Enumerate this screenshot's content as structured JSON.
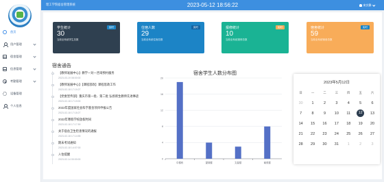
{
  "header": {
    "site_title": "理工学院宿舍管理系统",
    "datetime": "2023-05-12 18:56:22",
    "user_name": "宋文静"
  },
  "sidebar": {
    "items": [
      {
        "label": "首页",
        "icon": "home-icon",
        "active": true,
        "has_children": false
      },
      {
        "label": "用户管理",
        "icon": "user-icon",
        "active": false,
        "has_children": true
      },
      {
        "label": "宿舍管理",
        "icon": "box-icon",
        "active": false,
        "has_children": true
      },
      {
        "label": "信息管理",
        "icon": "box-icon",
        "active": false,
        "has_children": true
      },
      {
        "label": "考勤管理",
        "icon": "clock-icon",
        "active": false,
        "has_children": true
      },
      {
        "label": "设备管理",
        "icon": "gear-icon",
        "active": false,
        "has_children": false
      },
      {
        "label": "个人信息",
        "icon": "person-icon",
        "active": false,
        "has_children": false
      }
    ]
  },
  "stats": [
    {
      "title": "学生统计",
      "badge": "实时",
      "value": "30",
      "sub": "当前全系统学生总数",
      "bg": "#2f4050",
      "badge_bg": "#1c84c6"
    },
    {
      "title": "住宿人数",
      "badge": "实时",
      "value": "29",
      "sub": "当前全系统住宿总数",
      "bg": "#1c84c6",
      "badge_bg": "#1565a3"
    },
    {
      "title": "报修统计",
      "badge": "实时",
      "value": "10",
      "sub": "当前全系统报修总数",
      "bg": "#1ab394",
      "badge_bg": "#f8ac59"
    },
    {
      "title": "宿舍统计",
      "badge": "实时",
      "value": "59",
      "sub": "当前全系统宿舍总数",
      "bg": "#f8ac59",
      "badge_bg": "#1c84c6"
    }
  ],
  "notices": {
    "title": "宿舍通告",
    "items": [
      {
        "title": "【教师发展中心】教学一对一咨询预约服务",
        "date": "2023-03-19 08:00:00"
      },
      {
        "title": "【教师发展中心】【课程思政】课程思政工作",
        "date": "2023-02-18 17:19:27"
      },
      {
        "title": "【党委宣传部】重庆市第一批、第二批 弘扬新生教师先进事迹",
        "date": "2023-02-18 17:19:00"
      },
      {
        "title": "2022年度国家社会科学基金项目申报公告",
        "date": "2023-02-18 17:18:27"
      },
      {
        "title": "2022年寒假学校放假时间",
        "date": "2023-02-18 17:17:59"
      },
      {
        "title": "关于宿舍卫生检查情况的通报",
        "date": "2023-02-18 17:14:55"
      },
      {
        "title": "期末考试通知",
        "date": "2023-02-18 14:07:00"
      },
      {
        "title": "入住提醒",
        "date": "2023-02-14 00:00:00"
      }
    ]
  },
  "chart_data": {
    "type": "bar",
    "title": "宿舍学生人数分布图",
    "categories": [
      "中楼栋",
      "望湖楼",
      "文星楼",
      "南苑楼"
    ],
    "values": [
      19,
      4,
      3,
      8
    ],
    "ylim": [
      0,
      20
    ],
    "yticks": [
      0,
      4,
      8,
      12,
      16,
      20
    ],
    "color": "#5470c6",
    "grid": true
  },
  "calendar": {
    "title": "2023年5月12日",
    "weekdays": [
      "日",
      "一",
      "二",
      "三",
      "四",
      "五",
      "六"
    ],
    "weeks": [
      [
        {
          "d": "30",
          "m": true
        },
        {
          "d": "1"
        },
        {
          "d": "2"
        },
        {
          "d": "3"
        },
        {
          "d": "4"
        },
        {
          "d": "5"
        },
        {
          "d": "6"
        }
      ],
      [
        {
          "d": "7"
        },
        {
          "d": "8"
        },
        {
          "d": "9"
        },
        {
          "d": "10"
        },
        {
          "d": "11"
        },
        {
          "d": "12",
          "t": true
        },
        {
          "d": "13"
        }
      ],
      [
        {
          "d": "14"
        },
        {
          "d": "15"
        },
        {
          "d": "16"
        },
        {
          "d": "17"
        },
        {
          "d": "18"
        },
        {
          "d": "19"
        },
        {
          "d": "20"
        }
      ],
      [
        {
          "d": "21"
        },
        {
          "d": "22"
        },
        {
          "d": "23"
        },
        {
          "d": "24"
        },
        {
          "d": "25"
        },
        {
          "d": "26"
        },
        {
          "d": "27"
        }
      ],
      [
        {
          "d": "28"
        },
        {
          "d": "29"
        },
        {
          "d": "30"
        },
        {
          "d": "31"
        },
        {
          "d": "1",
          "m": true
        },
        {
          "d": "2",
          "m": true
        },
        {
          "d": "3",
          "m": true
        }
      ]
    ]
  }
}
